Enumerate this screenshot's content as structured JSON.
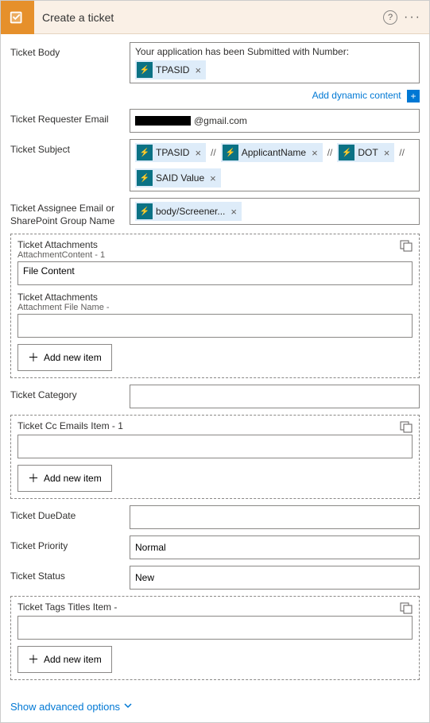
{
  "header": {
    "title": "Create a ticket"
  },
  "dynamic_link": "Add dynamic content",
  "rows": {
    "body": {
      "label": "Ticket Body",
      "prefix": "Your application has been Submitted with Number:",
      "token": "TPASID"
    },
    "requester": {
      "label": "Ticket Requester Email",
      "suffix": "@gmail.com"
    },
    "subject": {
      "label": "Ticket Subject",
      "tokens": [
        "TPASID",
        "ApplicantName",
        "DOT"
      ],
      "sep": "//",
      "token2": "SAID Value"
    },
    "assignee": {
      "label": "Ticket Assignee Email or SharePoint Group Name",
      "token": "body/Screener..."
    },
    "category": {
      "label": "Ticket Category"
    },
    "duedate": {
      "label": "Ticket DueDate"
    },
    "priority": {
      "label": "Ticket Priority",
      "value": "Normal"
    },
    "status": {
      "label": "Ticket Status",
      "value": "New"
    }
  },
  "arrays": {
    "attachments": {
      "label1": "Ticket Attachments",
      "sublabel1": "AttachmentContent - 1",
      "value1": "File Content",
      "label2": "Ticket Attachments",
      "sublabel2": "Attachment File Name -"
    },
    "cc": {
      "label": "Ticket Cc Emails Item - 1"
    },
    "tags": {
      "label": "Ticket Tags Titles Item -"
    }
  },
  "buttons": {
    "add_item": "Add new item"
  },
  "advanced": "Show advanced options"
}
